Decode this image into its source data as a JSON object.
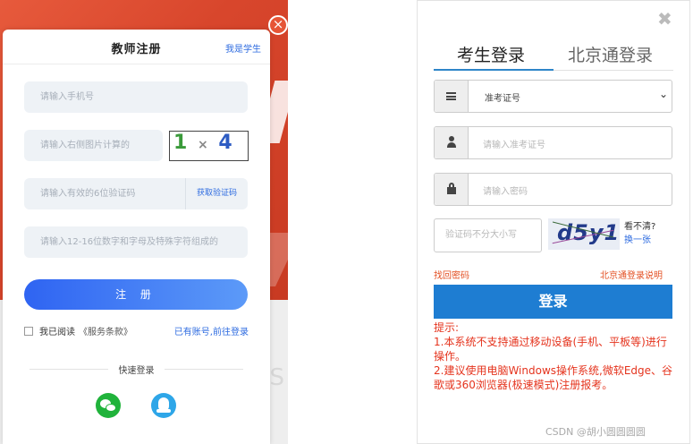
{
  "teacher_register": {
    "title": "教师注册",
    "student_link": "我是学生",
    "phone_placeholder": "请输入手机号",
    "captcha_placeholder": "请输入右侧图片计算的",
    "captcha_image": {
      "d1": "1",
      "op": "×",
      "d2": "4",
      "eq": "="
    },
    "sms_placeholder": "请输入有效的6位验证码",
    "get_code": "获取验证码",
    "password_placeholder": "请输入12-16位数字和字母及特殊字符组成的",
    "register_button": "注 册",
    "agree_text": "我已阅读",
    "terms_text": "《服务条款》",
    "login_link": "已有账号,前往登录",
    "quick_login": "快速登录",
    "social": [
      "wechat-icon",
      "qq-icon"
    ],
    "close": "×"
  },
  "student_login": {
    "close": "✖",
    "tabs": [
      {
        "label": "考生登录",
        "active": true
      },
      {
        "label": "北京通登录",
        "active": false
      }
    ],
    "id_type_value": "准考证号",
    "username_placeholder": "请输入准考证号",
    "password_placeholder": "请输入密码",
    "vcode_placeholder": "验证码不分大小写",
    "vcode_image_text": "d5y1",
    "vhint_line1": "看不清?",
    "vhint_line2": "换一张",
    "forgot_password": "找回密码",
    "bj_help": "北京通登录说明",
    "login_button": "登录",
    "tips": [
      "提示:",
      "1.本系统不支持通过移动设备(手机、平板等)进行操作。",
      "2.建议使用电脑Windows操作系统,微软Edge、谷歌或360浏览器(极速模式)注册报考。"
    ]
  },
  "watermark": "CSDN @胡小圆圆圆圆",
  "colors": {
    "accent_blue": "#2f6ce0",
    "login_blue": "#1e7dd2",
    "warn_red": "#e5341e",
    "bg_red": "#d8462c"
  }
}
